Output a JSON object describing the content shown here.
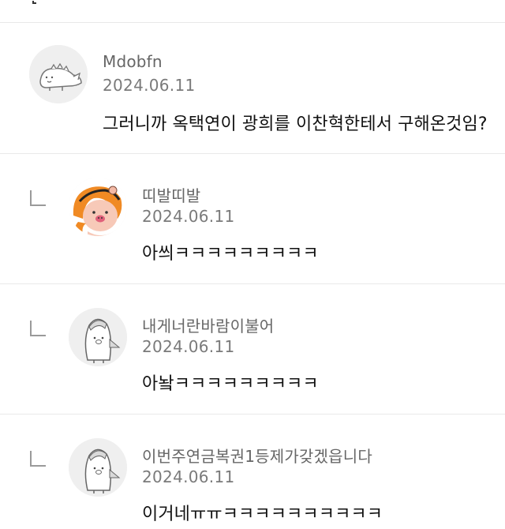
{
  "comments": [
    {
      "nickname": "Mdobfn",
      "date": "2024.06.11",
      "text": "그러니까 옥택연이 광희를 이찬혁한테서 구해온것임?",
      "avatar": "dinosaur-avatar"
    },
    {
      "nickname": "띠발띠발",
      "date": "2024.06.11",
      "text": "아씌ㅋㅋㅋㅋㅋㅋㅋㅋㅋ",
      "avatar": "orange-hair-bear-avatar"
    },
    {
      "nickname": "내게너란바람이불어",
      "date": "2024.06.11",
      "text": "아놬ㅋㅋㅋㅋㅋㅋㅋㅋㅋ",
      "avatar": "penguin-avatar"
    },
    {
      "nickname": "이번주연금복권1등제가갖겠읍니다",
      "date": "2024.06.11",
      "text": "이거네ㅠㅠㅋㅋㅋㅋㅋㅋㅋㅋㅋㅋ",
      "avatar": "penguin-avatar"
    }
  ]
}
